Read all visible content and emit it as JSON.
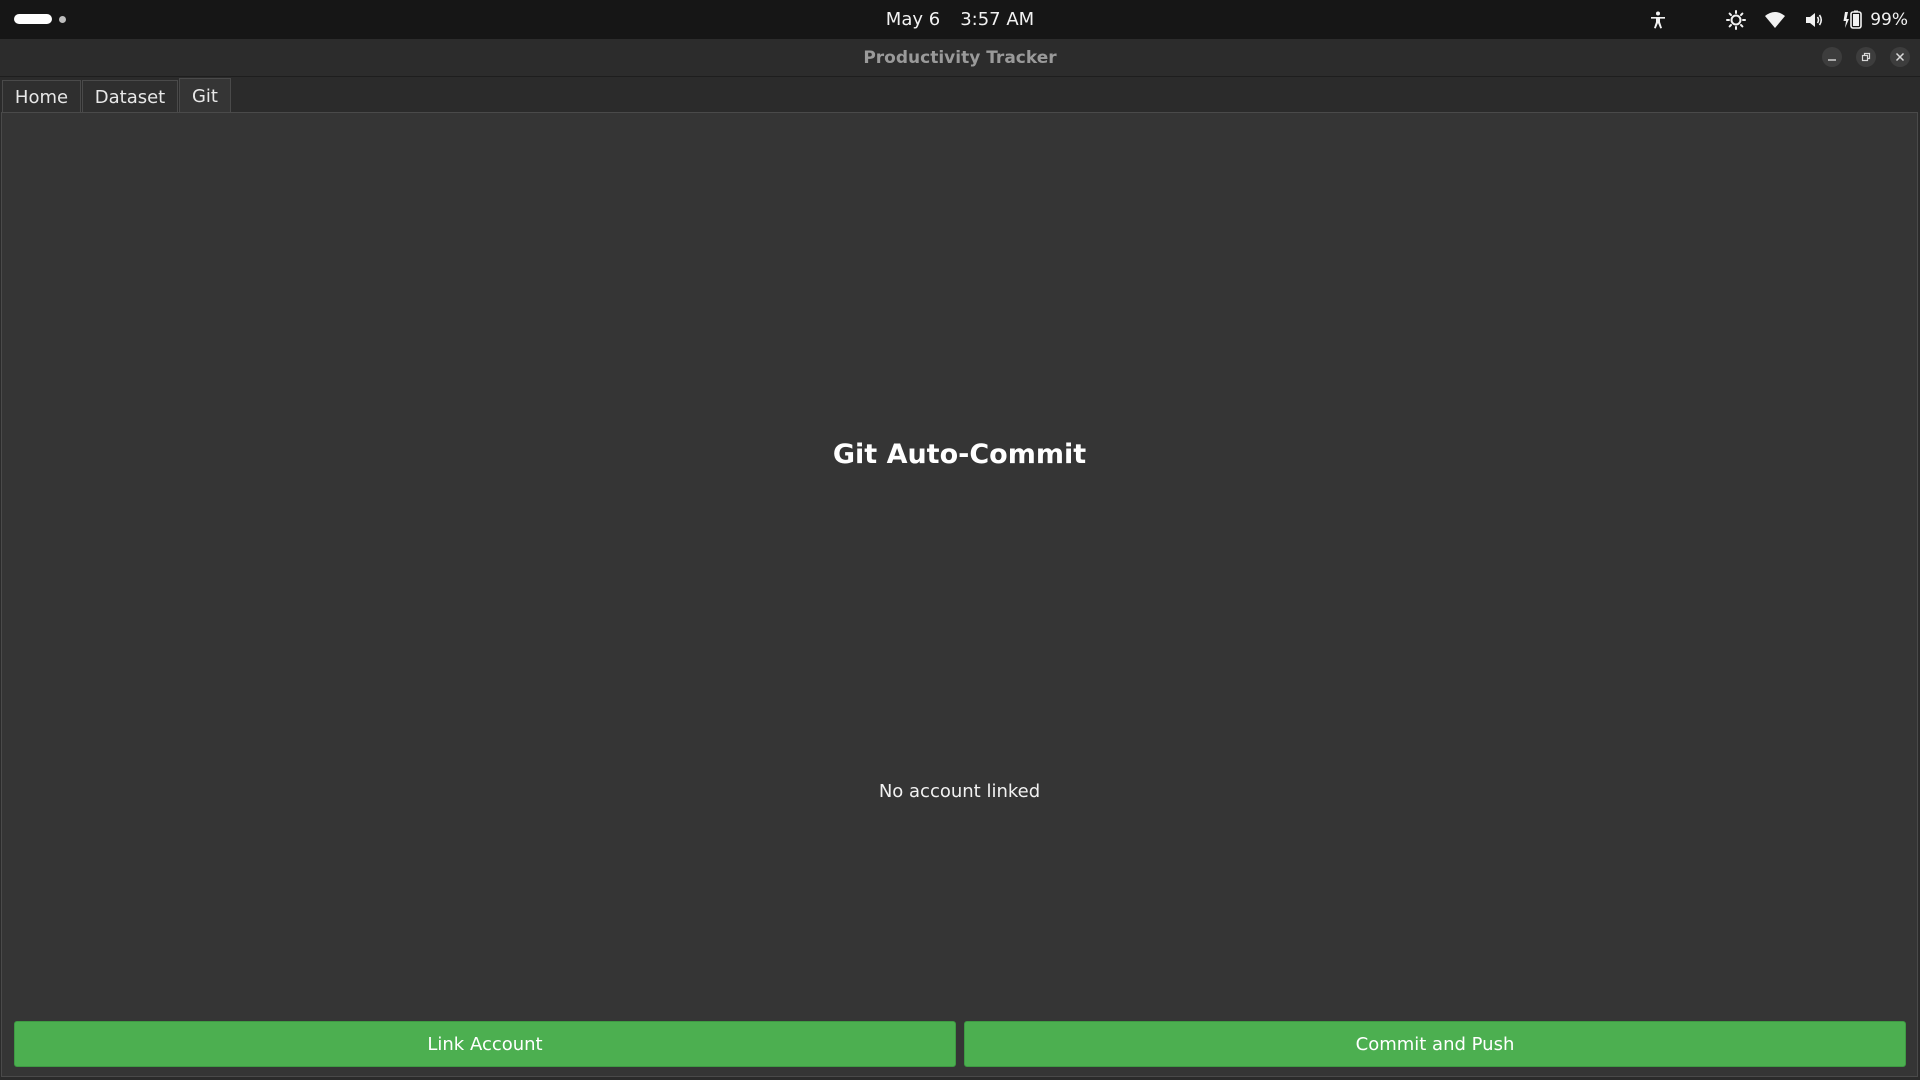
{
  "system_bar": {
    "date": "May 6",
    "time": "3:57 AM",
    "battery_percent": "99%"
  },
  "window": {
    "title": "Productivity Tracker"
  },
  "tabs": [
    {
      "label": "Home",
      "active": false
    },
    {
      "label": "Dataset",
      "active": false
    },
    {
      "label": "Git",
      "active": true
    }
  ],
  "main": {
    "heading": "Git Auto-Commit",
    "status_text": "No account linked",
    "link_button_label": "Link Account",
    "commit_button_label": "Commit and Push"
  },
  "colors": {
    "accent_green": "#4caf50",
    "panel_bg": "#353535",
    "topbar_bg": "#161616"
  }
}
